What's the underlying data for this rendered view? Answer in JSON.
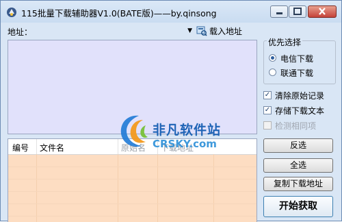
{
  "window": {
    "title": "115批量下载辅助器V1.0(BATE版)——by.qinsong"
  },
  "address": {
    "label": "地址：",
    "value": "",
    "load_button_label": "载入地址"
  },
  "list": {
    "columns": [
      "编号",
      "文件名",
      "原始名",
      "下载地址"
    ]
  },
  "priority": {
    "group_title": "优先选择",
    "options": [
      {
        "label": "电信下载",
        "selected": true
      },
      {
        "label": "联通下载",
        "selected": false
      }
    ]
  },
  "checkboxes": [
    {
      "label": "清除原始记录",
      "checked": true,
      "enabled": true
    },
    {
      "label": "存储下载文本",
      "checked": true,
      "enabled": true
    },
    {
      "label": "检测相同项",
      "checked": false,
      "enabled": false
    }
  ],
  "buttons": {
    "invert_select": "反选",
    "select_all": "全选",
    "copy_addresses": "复制下载地址",
    "start": "开始获取"
  },
  "watermark": {
    "line1": "非凡软件站",
    "line2": "CRSKY.com"
  },
  "colors": {
    "window_bg": "#d9e6f5",
    "main_panel_bg": "#e1e1fb",
    "list_bg": "#fdddc2",
    "close_button": "#c4433a"
  }
}
